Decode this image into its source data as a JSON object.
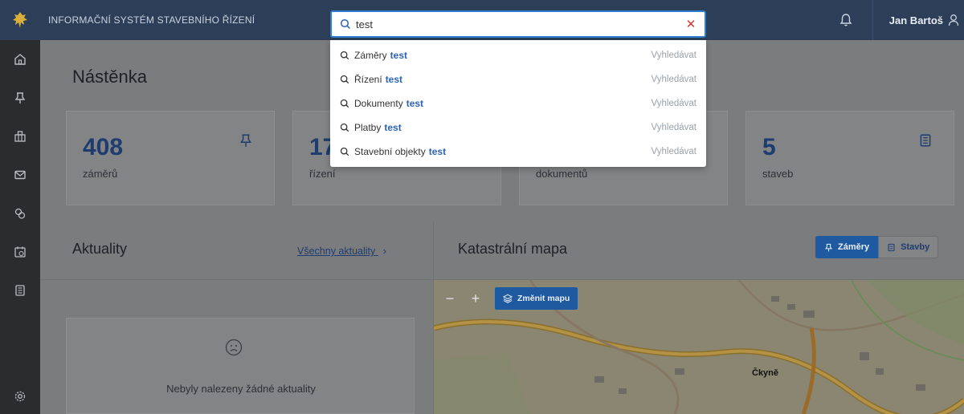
{
  "app": {
    "title": "INFORMAČNÍ SYSTÉM STAVEBNÍHO ŘÍZENÍ",
    "user_name": "Jan Bartoš"
  },
  "search": {
    "value": "test",
    "suggestions": [
      {
        "label": "Záměry",
        "query": "test",
        "action": "Vyhledávat"
      },
      {
        "label": "Řízení",
        "query": "test",
        "action": "Vyhledávat"
      },
      {
        "label": "Dokumenty",
        "query": "test",
        "action": "Vyhledávat"
      },
      {
        "label": "Platby",
        "query": "test",
        "action": "Vyhledávat"
      },
      {
        "label": "Stavební objekty",
        "query": "test",
        "action": "Vyhledávat"
      }
    ]
  },
  "page": {
    "title": "Nástěnka"
  },
  "stats": [
    {
      "value": "408",
      "label": "záměrů"
    },
    {
      "value": "17",
      "label": "řízení"
    },
    {
      "value": "",
      "label": "dokumentů"
    },
    {
      "value": "5",
      "label": "staveb"
    }
  ],
  "news": {
    "title": "Aktuality",
    "all_link": "Všechny aktuality",
    "empty_text": "Nebyly nalezeny žádné aktuality"
  },
  "map": {
    "title": "Katastrální mapa",
    "toggle_zamery": "Záměry",
    "toggle_stavby": "Stavby",
    "zoom_out": "−",
    "zoom_in": "+",
    "change_map": "Změnit mapu",
    "place_label": "Čkyně"
  },
  "colors": {
    "topbar": "#2c3e58",
    "accent": "#2f7fd0",
    "sidebar": "#2b2c2e"
  }
}
